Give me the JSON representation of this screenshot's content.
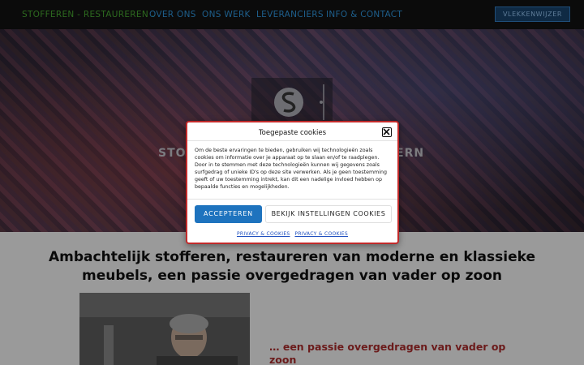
{
  "nav": {
    "items": [
      {
        "label": "STOFFEREN - RESTAUREREN",
        "has_dropdown": true,
        "active": true
      },
      {
        "label": "OVER ONS"
      },
      {
        "label": "ONS WERK"
      },
      {
        "label": "LEVERANCIERS"
      },
      {
        "label": "INFO & CONTACT"
      }
    ],
    "cta_label": "VLEKKENWIJZER",
    "dropdown_icon": "chevron-down-icon"
  },
  "hero": {
    "title_left": "STO",
    "title_right": "ERN",
    "logo_icon": "s-logo-icon"
  },
  "main": {
    "headline": "Ambachtelijk stofferen, restaureren van moderne en klassieke meubels, een passie overgedragen van vader op zoon",
    "subline": "… een passie overgedragen van vader op zoon"
  },
  "cookie_modal": {
    "title": "Toegepaste cookies",
    "body": "Om de beste ervaringen te bieden, gebruiken wij technologieën zoals cookies om informatie over je apparaat op te slaan en/of te raadplegen. Door in te stemmen met deze technologieën kunnen wij gegevens zoals surfgedrag of unieke ID's op deze site verwerken. Als je geen toestemming geeft of uw toestemming intrekt, kan dit een nadelige invloed hebben op bepaalde functies en mogelijkheden.",
    "accept_label": "ACCEPTEREN",
    "settings_label": "BEKIJK INSTELLINGEN COOKIES",
    "links": [
      "PRIVACY & COOKIES",
      "PRIVACY & COOKIES"
    ],
    "close_icon": "close-icon"
  },
  "colors": {
    "accent_blue": "#1e73be",
    "nav_active": "#2d6a1f",
    "nav_link": "#1e5f8c",
    "modal_border": "#c22a2a",
    "subline": "#6b1b1b"
  }
}
